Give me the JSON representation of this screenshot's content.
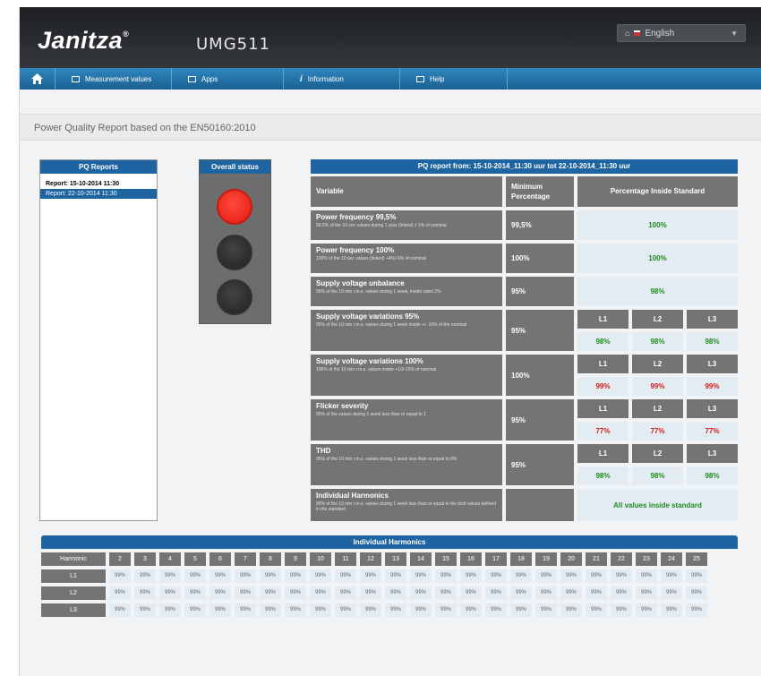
{
  "header": {
    "logo": "Janitza",
    "logo_mark": "®",
    "model": "UMG511",
    "language": {
      "current": "English"
    }
  },
  "nav": {
    "items": [
      {
        "label": "Measurement values",
        "icon": "table-icon"
      },
      {
        "label": "Apps",
        "icon": "apps-icon"
      },
      {
        "label": "Information",
        "icon": "info-icon"
      },
      {
        "label": "Help",
        "icon": "help-icon"
      }
    ]
  },
  "page_title": "Power Quality Report based on the EN50160:2010",
  "pq_reports": {
    "title": "PQ Reports",
    "items": [
      {
        "label": "Report: 15-10-2014 11:30",
        "selected": false
      },
      {
        "label": "Report: 22-10-2014 11:30",
        "selected": true
      }
    ]
  },
  "overall_status": {
    "title": "Overall status",
    "state": "red",
    "colors": {
      "red": "#e8271c",
      "off": "#2a2a2a"
    }
  },
  "report": {
    "title": "PQ report from: 15-10-2014_11:30 uur tot 22-10-2014_11:30 uur",
    "columns": {
      "variable": "Variable",
      "minimum": "Minimum Percentage",
      "inside": "Percentage Inside Standard"
    },
    "rows": [
      {
        "name": "Power frequency 99,5%",
        "desc": "99,5% of the 10 sec values during 1 year (linked) ± 1% of nominal",
        "minimum": "99,5%",
        "value": "100%"
      },
      {
        "name": "Power frequency 100%",
        "desc": "100% of the 10 sec values (linked) +4%/-6% of nominal",
        "minimum": "100%",
        "value": "100%"
      },
      {
        "name": "Supply voltage unbalance",
        "desc": "95% of the 10 min r.m.s. values during 1 week, inside rated 2%",
        "minimum": "95%",
        "value": "98%"
      },
      {
        "name": "Supply voltage variations 95%",
        "desc": "95% of the 10 min r.m.s. values during 1 week inside +/- 10% of the nominal",
        "minimum": "95%",
        "phases": [
          "L1",
          "L2",
          "L3"
        ],
        "values": [
          "98%",
          "98%",
          "98%"
        ],
        "colors": [
          "g",
          "g",
          "g"
        ]
      },
      {
        "name": "Supply voltage variations 100%",
        "desc": "100% of the 10 min r.m.s. values inside +10/-15% of nominal",
        "minimum": "100%",
        "phases": [
          "L1",
          "L2",
          "L3"
        ],
        "values": [
          "99%",
          "99%",
          "99%"
        ],
        "colors": [
          "r",
          "r",
          "r"
        ]
      },
      {
        "name": "Flicker severity",
        "desc": "95% of the values during 1 week less than or equal to 1",
        "minimum": "95%",
        "phases": [
          "L1",
          "L2",
          "L3"
        ],
        "values": [
          "77%",
          "77%",
          "77%"
        ],
        "colors": [
          "r",
          "r",
          "r"
        ]
      },
      {
        "name": "THD",
        "desc": "95% of the 10 min r.m.s. values during 1 week less than or equal to 8%",
        "minimum": "95%",
        "phases": [
          "L1",
          "L2",
          "L3"
        ],
        "values": [
          "98%",
          "98%",
          "98%"
        ],
        "colors": [
          "g",
          "g",
          "g"
        ]
      },
      {
        "name": "Individual Harmonics",
        "desc": "95% of the 10 min r.m.s. values during 1 week less than or equal to the limit values defined in the standard",
        "minimum": "",
        "value": "All values inside standard"
      }
    ]
  },
  "harmonics": {
    "title": "Individual Harmonics",
    "number_label": "Harmonic",
    "numbers": [
      "2",
      "3",
      "4",
      "5",
      "6",
      "7",
      "8",
      "9",
      "10",
      "11",
      "12",
      "13",
      "14",
      "15",
      "16",
      "17",
      "18",
      "19",
      "20",
      "21",
      "22",
      "23",
      "24",
      "25"
    ],
    "rows": [
      {
        "label": "L1",
        "values": [
          "99%",
          "99%",
          "99%",
          "99%",
          "99%",
          "99%",
          "99%",
          "99%",
          "99%",
          "99%",
          "99%",
          "99%",
          "99%",
          "99%",
          "99%",
          "99%",
          "99%",
          "99%",
          "99%",
          "99%",
          "99%",
          "99%",
          "99%",
          "99%"
        ]
      },
      {
        "label": "L2",
        "values": [
          "99%",
          "99%",
          "99%",
          "99%",
          "99%",
          "99%",
          "99%",
          "99%",
          "99%",
          "99%",
          "99%",
          "99%",
          "99%",
          "99%",
          "99%",
          "99%",
          "99%",
          "99%",
          "99%",
          "99%",
          "99%",
          "99%",
          "99%",
          "99%"
        ]
      },
      {
        "label": "L3",
        "values": [
          "99%",
          "99%",
          "99%",
          "99%",
          "99%",
          "99%",
          "99%",
          "99%",
          "99%",
          "99%",
          "99%",
          "99%",
          "99%",
          "99%",
          "99%",
          "99%",
          "99%",
          "99%",
          "99%",
          "99%",
          "99%",
          "99%",
          "99%",
          "99%"
        ]
      }
    ]
  }
}
